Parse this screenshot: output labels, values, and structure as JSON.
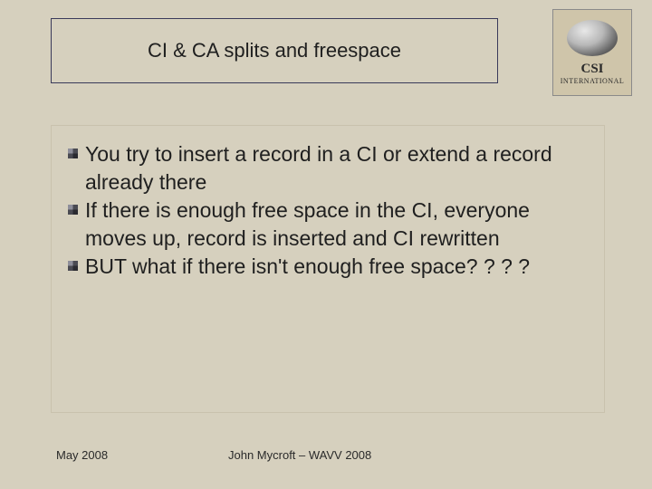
{
  "title": "CI & CA splits and freespace",
  "logo": {
    "main": "CSI",
    "sub": "INTERNATIONAL"
  },
  "bullets": [
    "You try to insert a record in a CI or extend a record already there",
    "If there is enough free space in the CI, everyone moves up, record is inserted and CI rewritten",
    "BUT what if there isn't enough free space? ? ? ?"
  ],
  "footer": {
    "date": "May 2008",
    "author": "John Mycroft – WAVV 2008"
  }
}
